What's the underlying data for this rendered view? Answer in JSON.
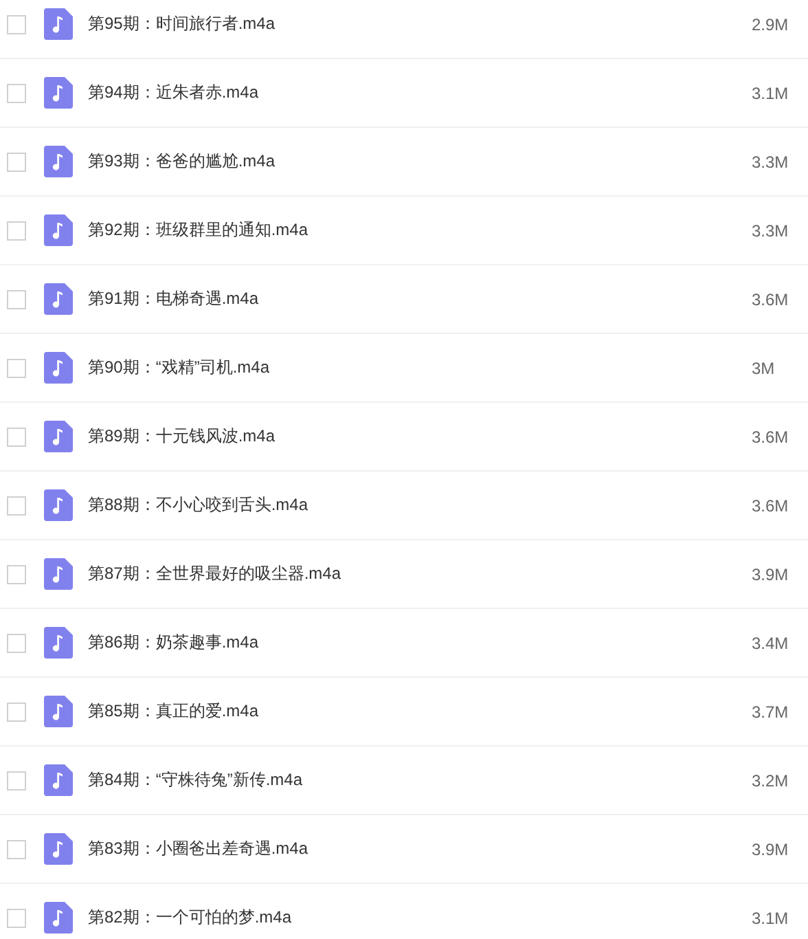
{
  "files": [
    {
      "name": "第95期：时间旅行者.m4a",
      "size": "2.9M",
      "checked": false
    },
    {
      "name": "第94期：近朱者赤.m4a",
      "size": "3.1M",
      "checked": false
    },
    {
      "name": "第93期：爸爸的尴尬.m4a",
      "size": "3.3M",
      "checked": false
    },
    {
      "name": "第92期：班级群里的通知.m4a",
      "size": "3.3M",
      "checked": false
    },
    {
      "name": "第91期：电梯奇遇.m4a",
      "size": "3.6M",
      "checked": false
    },
    {
      "name": "第90期：“戏精”司机.m4a",
      "size": "3M",
      "checked": false
    },
    {
      "name": "第89期：十元钱风波.m4a",
      "size": "3.6M",
      "checked": false
    },
    {
      "name": "第88期：不小心咬到舌头.m4a",
      "size": "3.6M",
      "checked": false
    },
    {
      "name": "第87期：全世界最好的吸尘器.m4a",
      "size": "3.9M",
      "checked": false
    },
    {
      "name": "第86期：奶茶趣事.m4a",
      "size": "3.4M",
      "checked": false
    },
    {
      "name": "第85期：真正的爱.m4a",
      "size": "3.7M",
      "checked": false
    },
    {
      "name": "第84期：“守株待兔”新传.m4a",
      "size": "3.2M",
      "checked": false
    },
    {
      "name": "第83期：小圈爸出差奇遇.m4a",
      "size": "3.9M",
      "checked": false
    },
    {
      "name": "第82期：一个可怕的梦.m4a",
      "size": "3.1M",
      "checked": false
    }
  ]
}
